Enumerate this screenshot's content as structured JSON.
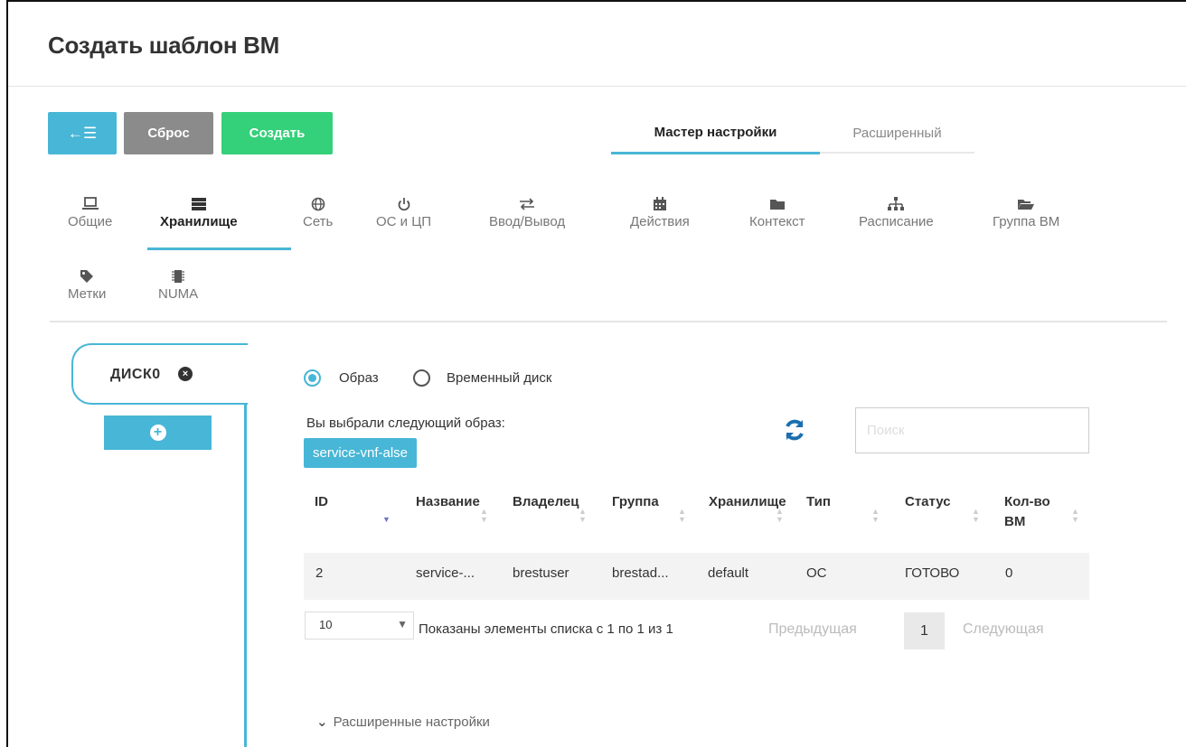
{
  "page": {
    "title": "Создать шаблон ВМ"
  },
  "toolbar": {
    "back_icon": "←☰",
    "reset_label": "Сброс",
    "create_label": "Создать"
  },
  "mode_tabs": [
    {
      "label": "Мастер настройки",
      "active": true
    },
    {
      "label": "Расширенный",
      "active": false
    }
  ],
  "section_tabs": [
    {
      "label": "Общие",
      "icon": "laptop-icon",
      "glyph": "💻"
    },
    {
      "label": "Хранилище",
      "icon": "storage-icon",
      "glyph": "☰",
      "active": true
    },
    {
      "label": "Сеть",
      "icon": "globe-icon",
      "glyph": "🌐"
    },
    {
      "label": "ОС и ЦП",
      "icon": "power-icon",
      "glyph": "⏻"
    },
    {
      "label": "Ввод/Вывод",
      "icon": "exchange-icon",
      "glyph": "⇄"
    },
    {
      "label": "Действия",
      "icon": "calendar-icon",
      "glyph": "▦"
    },
    {
      "label": "Контекст",
      "icon": "folder-icon",
      "glyph": "▬"
    },
    {
      "label": "Расписание",
      "icon": "sitemap-icon",
      "glyph": "⊥"
    },
    {
      "label": "Группа ВМ",
      "icon": "folder-open-icon",
      "glyph": "▰"
    },
    {
      "label": "Метки",
      "icon": "tag-icon",
      "glyph": "◆"
    },
    {
      "label": "NUMA",
      "icon": "chip-icon",
      "glyph": "▦"
    }
  ],
  "disks": {
    "tab_label": "ДИСК0",
    "close_glyph": "×",
    "add_glyph": "+"
  },
  "disk_source": {
    "options": [
      {
        "label": "Образ",
        "checked": true
      },
      {
        "label": "Временный диск",
        "checked": false
      }
    ],
    "selected_text": "Вы выбрали следующий образ:",
    "selected_image": "service-vnf-alse",
    "refresh_glyph": "↻",
    "search_placeholder": "Поиск"
  },
  "table": {
    "columns": [
      "ID",
      "Название",
      "Владелец",
      "Группа",
      "Хранилище",
      "Тип",
      "Статус",
      "Кол-во ВМ"
    ],
    "rows": [
      [
        "2",
        "service-...",
        "brestuser",
        "brestad...",
        "default",
        "ОС",
        "ГОТОВО",
        "0"
      ]
    ],
    "sort_active": "ID"
  },
  "pagination": {
    "page_size": "10",
    "showing": "Показаны элементы списка с 1 по 1 из 1",
    "prev": "Предыдущая",
    "current": "1",
    "next": "Следующая"
  },
  "advanced": {
    "label": "Расширенные настройки"
  },
  "colors": {
    "accent": "#48b6d6",
    "reset": "#8b8b8b",
    "create": "#35d07a",
    "refresh": "#1a6fb0"
  }
}
